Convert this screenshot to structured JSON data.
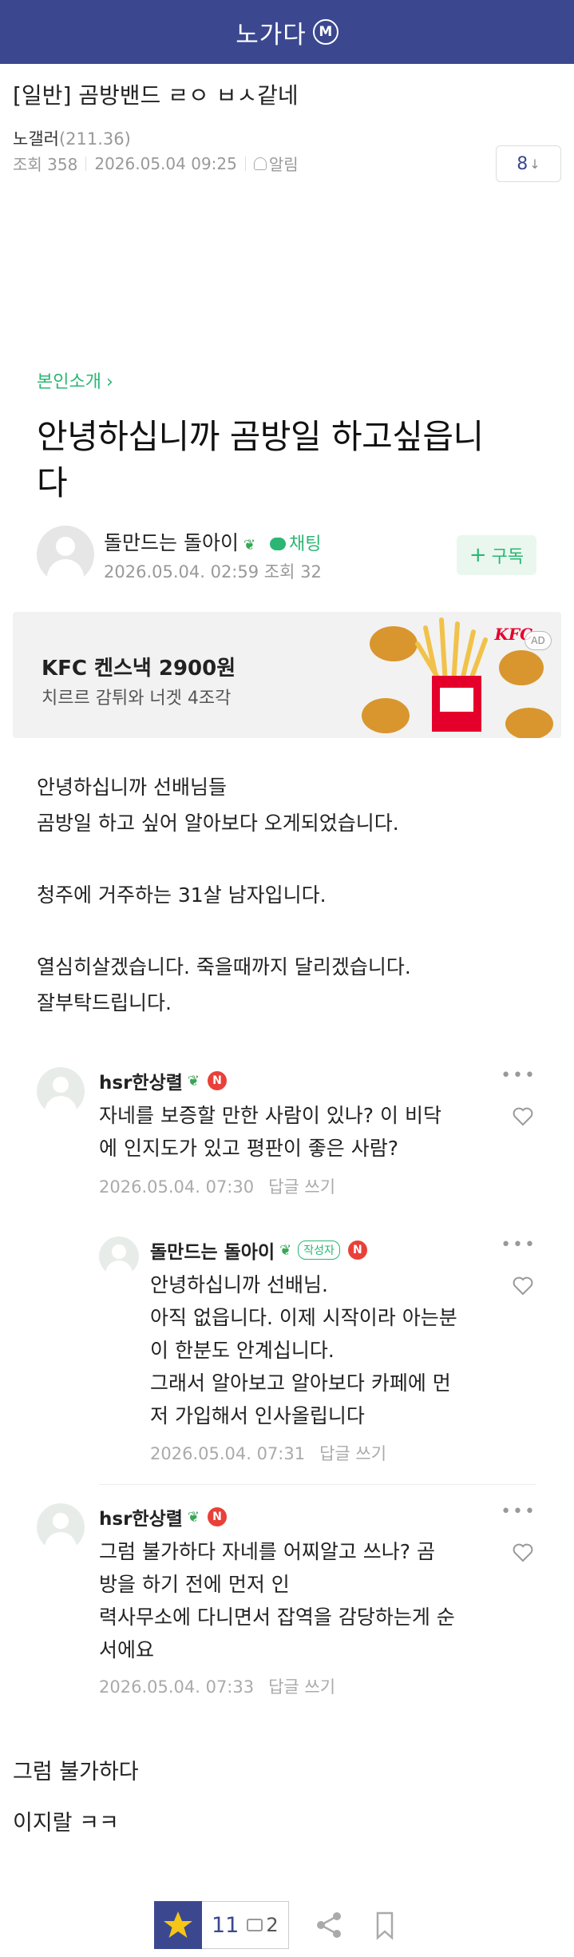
{
  "topbar": {
    "title": "노가다",
    "badge": "M"
  },
  "post": {
    "title": "[일반] 곰방밴드 ㄹㅇ ㅂㅅ같네",
    "author": "노갤러",
    "author_ip": "(211.36)",
    "views": "조회 358",
    "datetime": "2026.05.04 09:25",
    "alarm": "알림",
    "comment_count": "8",
    "comment_arrow": "↓"
  },
  "article": {
    "category": "본인소개",
    "category_chevron": "›",
    "headline_lines": [
      "안녕하십니까 곰방일 하고싶읍니",
      "다"
    ],
    "author_name": "돌만드는 돌아이",
    "chat": "채팅",
    "author_meta": "2026.05.04. 02:59  조회 32",
    "subscribe": "구독",
    "subscribe_plus": "+"
  },
  "ad": {
    "title": "KFC 켄스낵 2900원",
    "subtitle": "치르르 감튀와 너겟 4조각",
    "logo": "KFC",
    "badge": "AD"
  },
  "content": {
    "lines": [
      "안녕하십니까 선배님들",
      "곰방일 하고 싶어 알아보다 오게되었습니다.",
      "",
      "청주에 거주하는 31살 남자입니다.",
      "",
      "열심히살겠습니다. 죽을때까지 달리겠습니다.",
      "잘부탁드립니다."
    ]
  },
  "comments": [
    {
      "name": "hsr한상렬",
      "badge": "N",
      "lines": [
        "자네를 보증할 만한 사람이 있나? 이 비닥",
        "에 인지도가 있고 평판이 좋은 사람?"
      ],
      "date": "2026.05.04. 07:30",
      "reply": "답글 쓰기"
    },
    {
      "name": "돌만드는 돌아이",
      "writer": "작성자",
      "badge": "N",
      "lines": [
        "안녕하십니까 선배님.",
        "아직 없읍니다. 이제 시작이라 아는분",
        "이 한분도 안계십니다.",
        "그래서 알아보고 알아보다 카페에 먼",
        "저 가입해서 인사올립니다"
      ],
      "date": "2026.05.04. 07:31",
      "reply": "답글 쓰기"
    },
    {
      "name": "hsr한상렬",
      "badge": "N",
      "lines": [
        "그럼 불가하다 자네를 어찌알고 쓰나?  곰",
        "방을 하기 전에 먼저 인",
        "력사무소에 다니면서 잡역을 감당하는게 순",
        "서에요"
      ],
      "date": "2026.05.04. 07:33",
      "reply": "답글 쓰기"
    }
  ],
  "after": {
    "line1": "그럼 불가하다",
    "line2": "이지랄 ㅋㅋ"
  },
  "bottom": {
    "stars": "11",
    "comments": "2"
  },
  "icons": {
    "more": "more-icon",
    "heart": "heart-icon",
    "share": "share-icon",
    "bookmark": "bookmark-icon",
    "star": "star-icon"
  },
  "colors": {
    "brand": "#3b4890",
    "green": "#2bb673",
    "badge_red": "#e8413a"
  }
}
